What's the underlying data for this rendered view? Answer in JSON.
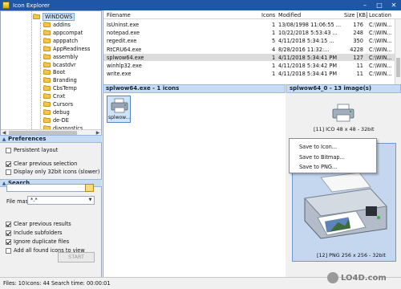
{
  "window": {
    "title": "Icon Explorer"
  },
  "tree": {
    "root": "WINDOWS",
    "items": [
      "addins",
      "appcompat",
      "apppatch",
      "AppReadiness",
      "assembly",
      "bcastdvr",
      "Boot",
      "Branding",
      "CbsTemp",
      "Cnxt",
      "Cursors",
      "debug",
      "de-DE",
      "diagnostics"
    ]
  },
  "preferences": {
    "title": "Preferences",
    "persistent_layout": "Persistent layout",
    "clear_previous_selection": "Clear previous selection",
    "display_32bit": "Display only 32bit icons (slower)"
  },
  "search": {
    "title": "Search",
    "file_mask_label": "File mask:",
    "file_mask_value": "*.*",
    "clear_previous_results": "Clear previous results",
    "include_subfolders": "Include subfolders",
    "ignore_duplicate_files": "Ignore duplicate files",
    "add_all_found": "Add all found icons to view",
    "start_button": "START"
  },
  "list": {
    "headers": {
      "filename": "Filename",
      "icons": "Icons",
      "modified": "Modified",
      "size": "Size [KB]",
      "location": "Location"
    },
    "rows": [
      {
        "filename": "IsUninst.exe",
        "icons": "1",
        "modified": "13/08/1998 11:06:55 ...",
        "size": "176",
        "location": "C:\\WIN..."
      },
      {
        "filename": "notepad.exe",
        "icons": "1",
        "modified": "10/22/2018 5:53:43 ...",
        "size": "248",
        "location": "C:\\WIN..."
      },
      {
        "filename": "regedit.exe",
        "icons": "5",
        "modified": "4/11/2018 5:34:15 ...",
        "size": "350",
        "location": "C:\\WIN..."
      },
      {
        "filename": "RtCRU64.exe",
        "icons": "4",
        "modified": "8/28/2016 11:32:...",
        "size": "4228",
        "location": "C:\\WIN..."
      },
      {
        "filename": "splwow64.exe",
        "icons": "1",
        "modified": "4/11/2018 5:34:41 PM",
        "size": "127",
        "location": "C:\\WIN..."
      },
      {
        "filename": "winhlp32.exe",
        "icons": "1",
        "modified": "4/11/2018 5:34:42 PM",
        "size": "11",
        "location": "C:\\WIN..."
      },
      {
        "filename": "write.exe",
        "icons": "1",
        "modified": "4/11/2018 5:34:41 PM",
        "size": "11",
        "location": "C:\\WIN..."
      }
    ]
  },
  "icons_panel": {
    "title": "splwow64.exe - 1 icons",
    "tile_label": "splwow..."
  },
  "images_panel": {
    "title": "splwow64_0 - 13 image(s)",
    "top_caption": "[11] ICO 48 x 48 - 32bit",
    "bottom_caption": "[12] PNG 256 x 256 - 32bit"
  },
  "context_menu": {
    "items": [
      "Save to Icon...",
      "Save to Bitmap...",
      "Save to PNG..."
    ]
  },
  "status": {
    "files": "Files: 10",
    "icons": "Icons: 44",
    "time": "Search time: 00:00:01"
  },
  "watermark": {
    "text": "LO4D.com"
  },
  "colors": {
    "titlebar": "#1f56a5",
    "section": "#c7dcf4",
    "selection": "#cfe3fa"
  }
}
